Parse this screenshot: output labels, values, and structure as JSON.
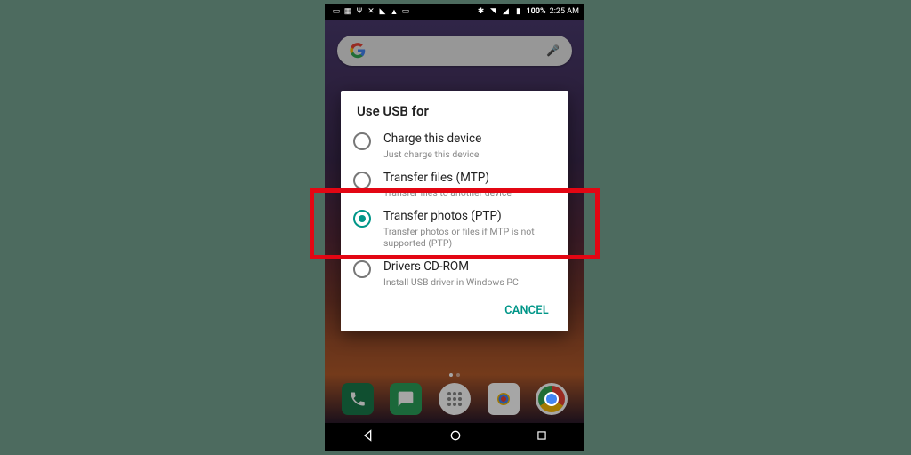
{
  "statusbar": {
    "battery": "100%",
    "time": "2:25 AM"
  },
  "dialog": {
    "title": "Use USB for",
    "options": [
      {
        "label": "Charge this device",
        "sub": "Just charge this device",
        "selected": false
      },
      {
        "label": "Transfer files (MTP)",
        "sub": "Transfer files to another device",
        "selected": false
      },
      {
        "label": "Transfer photos (PTP)",
        "sub": "Transfer photos or files if MTP is not supported (PTP)",
        "selected": true
      },
      {
        "label": "Drivers CD-ROM",
        "sub": "Install USB driver in Windows PC",
        "selected": false
      }
    ],
    "cancel": "CANCEL"
  },
  "highlight_option_index": 2
}
